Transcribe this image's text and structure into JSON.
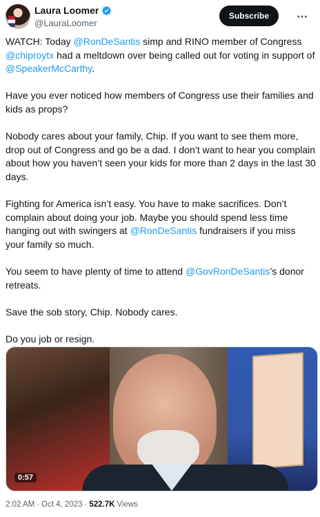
{
  "author": {
    "display_name": "Laura Loomer",
    "handle": "@LauraLoomer",
    "verified_color": "#1d9bf0"
  },
  "subscribe_label": "Subscribe",
  "tweet": {
    "p1_a": "WATCH: Today ",
    "p1_m1": "@RonDeSantis",
    "p1_b": " simp and RINO member of Congress ",
    "p1_m2": "@chiproytx",
    "p1_c": " had a meltdown over being called out for voting in support of ",
    "p1_m3": "@SpeakerMcCarthy",
    "p1_d": ".",
    "p2": "Have you ever noticed how members of Congress use their families and kids as props?",
    "p3": "Nobody cares about your family, Chip. If you want to see them more, drop out of Congress and go be a dad. I don’t want to hear you complain about how you haven’t seen your kids for more than 2 days in the last 30 days.",
    "p4_a": "Fighting for America isn’t easy. You have to make sacrifices. Don’t complain about doing your job. Maybe you should spend less time hanging out with swingers at ",
    "p4_m1": "@RonDeSantis",
    "p4_b": " fundraisers if you miss your family so much.",
    "p5_a": "You seem to have plenty of time to attend ",
    "p5_m1": "@GovRonDeSantis",
    "p5_b": "’s donor retreats.",
    "p6": "Save the sob story, Chip. Nobody cares.",
    "p7": "Do you job or resign."
  },
  "video": {
    "duration": "0:57"
  },
  "meta": {
    "time": "2:02 AM",
    "separator": "·",
    "date": "Oct 4, 2023",
    "views_count": "522.7K",
    "views_label": "Views"
  }
}
